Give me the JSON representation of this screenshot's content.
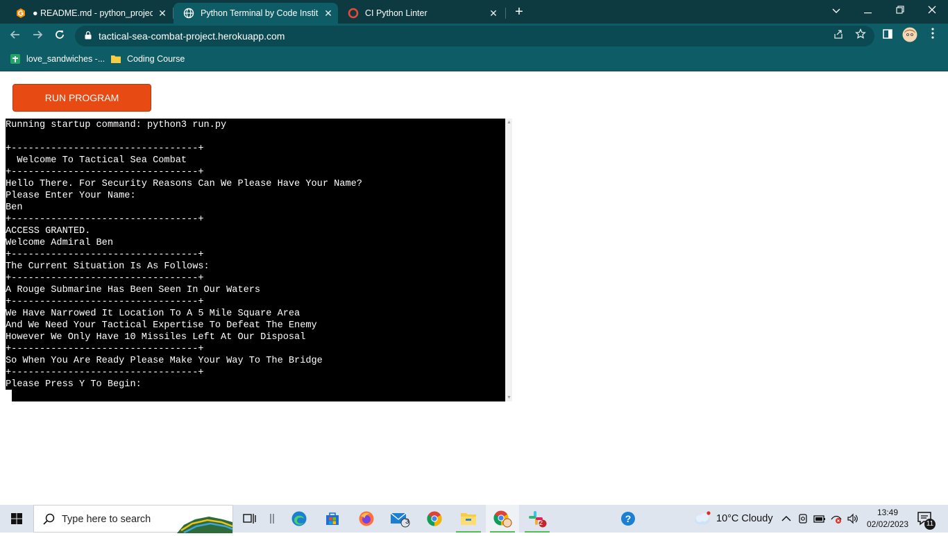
{
  "browser": {
    "tabs": [
      {
        "title": "● README.md - python_project -",
        "icon": "gitpod-logo-icon",
        "active": false
      },
      {
        "title": "Python Terminal by Code Institute",
        "icon": "globe-icon",
        "active": true
      },
      {
        "title": "CI Python Linter",
        "icon": "ci-logo-icon",
        "active": false
      }
    ],
    "close_glyph": "✕",
    "new_tab_glyph": "+",
    "url": "tactical-sea-combat-project.herokuapp.com",
    "bookmarks": [
      {
        "label": "love_sandwiches -...",
        "icon": "google-sheets-icon"
      },
      {
        "label": "Coding Course",
        "icon": "folder-icon"
      }
    ]
  },
  "page": {
    "run_button": "RUN PROGRAM",
    "terminal_lines": [
      "Running startup command: python3 run.py",
      "",
      "+---------------------------------+",
      "  Welcome To Tactical Sea Combat",
      "+---------------------------------+",
      "Hello There. For Security Reasons Can We Please Have Your Name?",
      "Please Enter Your Name:",
      "Ben",
      "+---------------------------------+",
      "ACCESS GRANTED.",
      "Welcome Admiral Ben",
      "+---------------------------------+",
      "The Current Situation Is As Follows:",
      "+---------------------------------+",
      "A Rouge Submarine Has Been Seen In Our Waters",
      "+---------------------------------+",
      "We Have Narrowed It Location To A 5 Mile Square Area",
      "And We Need Your Tactical Expertise To Defeat The Enemy",
      "However We Only Have 10 Missiles Left At Our Disposal",
      "+---------------------------------+",
      "So When You Are Ready Please Make Your Way To The Bridge",
      "+---------------------------------+",
      "Please Press Y To Begin:"
    ]
  },
  "taskbar": {
    "search_placeholder": "Type here to search",
    "weather": "10°C  Cloudy",
    "time": "13:49",
    "date": "02/02/2023",
    "mail_badge": "3",
    "slack_badge": "2",
    "notification_count": "11"
  },
  "colors": {
    "tabbar": "#0d3a40",
    "toolbar": "#0e5c66",
    "run_button": "#e84a13",
    "terminal_bg": "#000000"
  }
}
